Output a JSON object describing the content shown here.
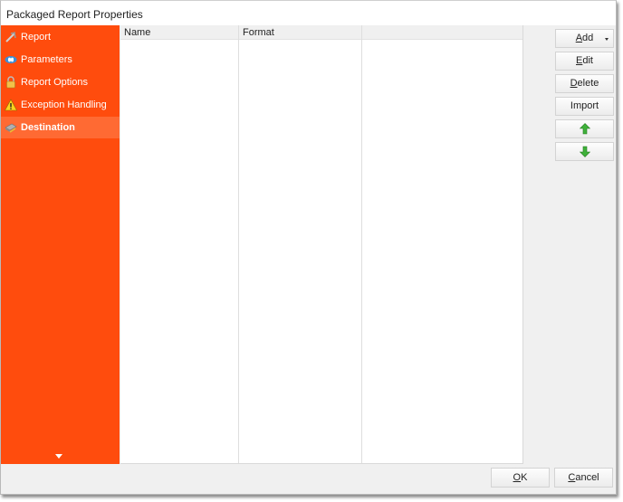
{
  "window": {
    "title": "Packaged Report Properties"
  },
  "sidebar": {
    "items": [
      {
        "label": "Report",
        "icon": "report-wand-icon",
        "active": false
      },
      {
        "label": "Parameters",
        "icon": "parameters-icon",
        "active": false
      },
      {
        "label": "Report Options",
        "icon": "padlock-icon",
        "active": false
      },
      {
        "label": "Exception Handling",
        "icon": "warning-icon",
        "active": false
      },
      {
        "label": "Destination",
        "icon": "destination-icon",
        "active": true
      }
    ],
    "scroll_icon": "chevron-down-icon",
    "accent": "#ff4c0d",
    "active_bg": "#ff6a33"
  },
  "list": {
    "columns": [
      "Name",
      "Format",
      ""
    ],
    "rows": []
  },
  "actions": {
    "add": {
      "pre": "",
      "u": "A",
      "post": "dd"
    },
    "edit": {
      "pre": "",
      "u": "E",
      "post": "dit"
    },
    "delete": {
      "pre": "",
      "u": "D",
      "post": "elete"
    },
    "import": "Import",
    "move_up_icon": "arrow-up-icon",
    "move_down_icon": "arrow-down-icon",
    "arrow_color": "#3fb13a"
  },
  "footer": {
    "ok": {
      "u": "O",
      "post": "K"
    },
    "cancel": {
      "u": "C",
      "post": "ancel"
    }
  }
}
